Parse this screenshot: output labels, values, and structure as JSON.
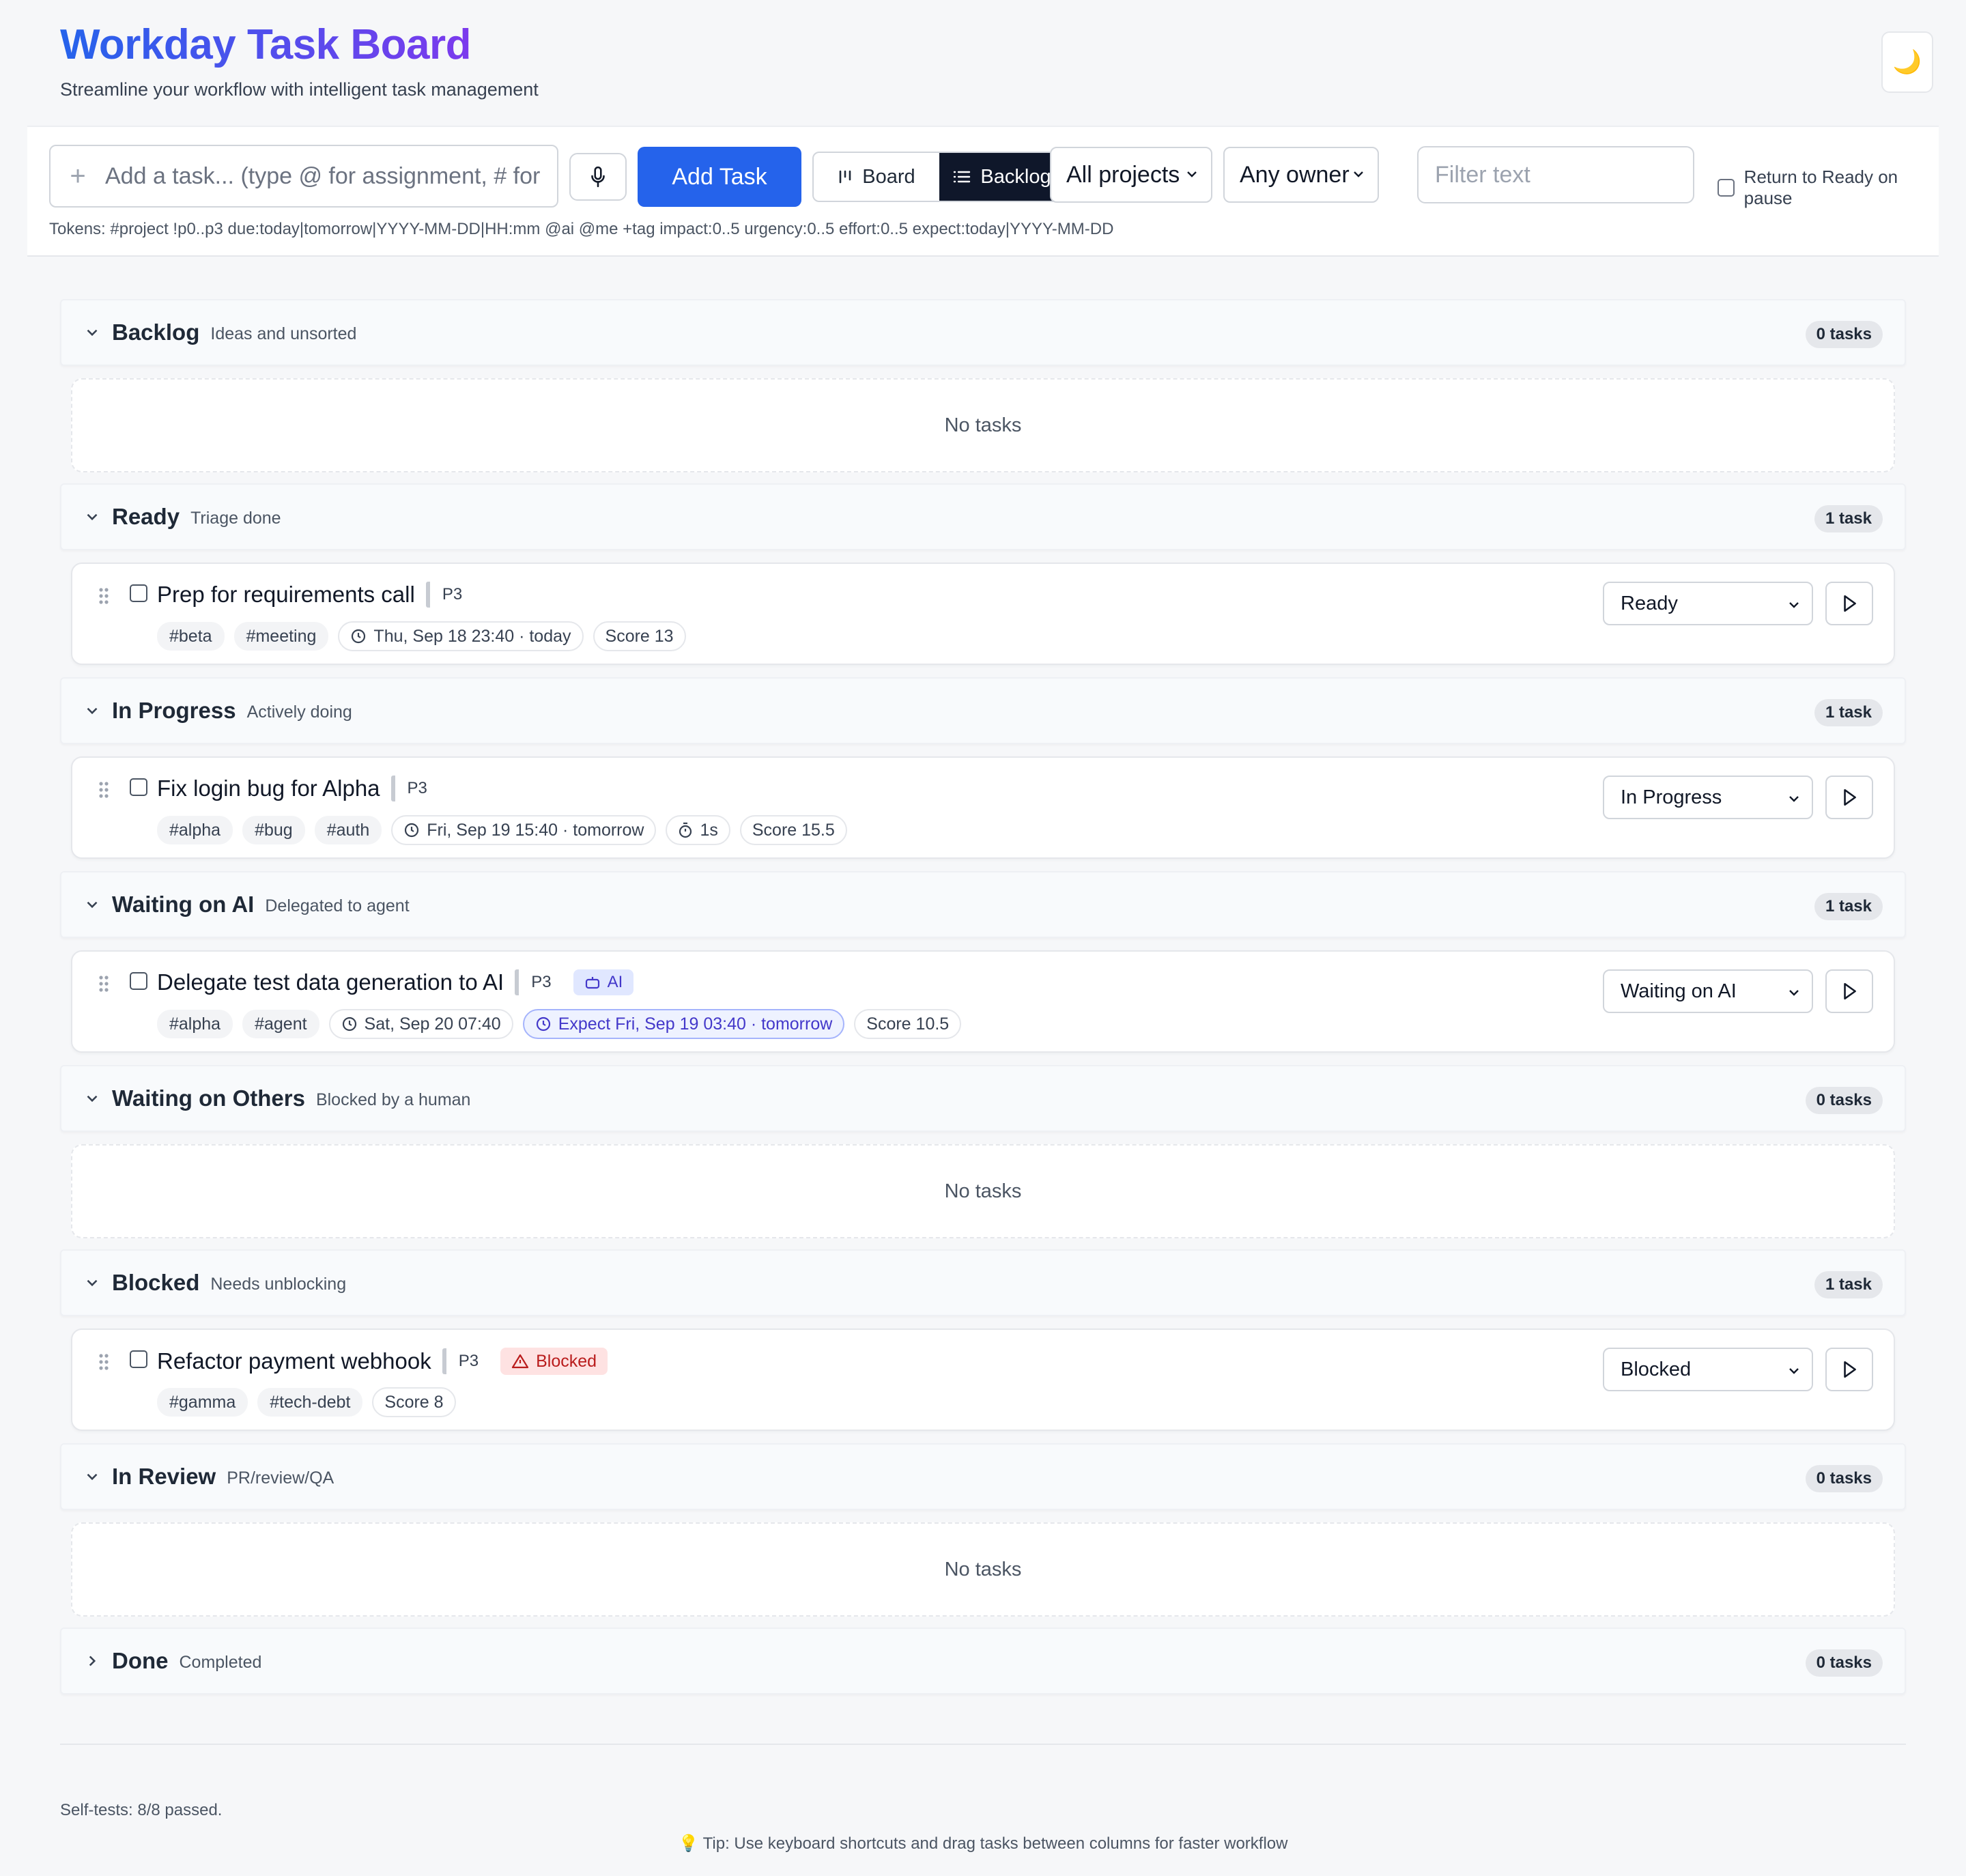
{
  "header": {
    "title": "Workday Task Board",
    "subtitle": "Streamline your workflow with intelligent task management",
    "theme_icon": "🌙"
  },
  "toolbar": {
    "task_placeholder": "Add a task... (type @ for assignment, # for project)",
    "add_label": "Add Task",
    "views": [
      {
        "label": "Board",
        "active": false
      },
      {
        "label": "Backlog",
        "active": true
      }
    ],
    "project_filter": "All projects",
    "owner_filter": "Any owner",
    "filter_placeholder": "Filter text",
    "pause_label": "Return to Ready on pause",
    "tokens_hint": "Tokens: #project !p0..p3 due:today|tomorrow|YYYY-MM-DD|HH:mm @ai @me +tag impact:0..5 urgency:0..5 effort:0..5 expect:today|YYYY-MM-DD"
  },
  "sections": [
    {
      "title": "Backlog",
      "subtitle": "Ideas and unsorted",
      "count": "0 tasks",
      "empty": "No tasks",
      "expanded": true
    },
    {
      "title": "Ready",
      "subtitle": "Triage done",
      "count": "1 task",
      "expanded": true,
      "task": {
        "title": "Prep for requirements call",
        "priority": "P3",
        "tags": [
          "#beta",
          "#meeting"
        ],
        "due": "Thu, Sep 18 23:40 · today",
        "score": "Score 13",
        "status": "Ready"
      }
    },
    {
      "title": "In Progress",
      "subtitle": "Actively doing",
      "count": "1 task",
      "expanded": true,
      "task": {
        "title": "Fix login bug for Alpha",
        "priority": "P3",
        "tags": [
          "#alpha",
          "#bug",
          "#auth"
        ],
        "due": "Fri, Sep 19 15:40 · tomorrow",
        "timer": "1s",
        "score": "Score 15.5",
        "status": "In Progress"
      }
    },
    {
      "title": "Waiting on AI",
      "subtitle": "Delegated to agent",
      "count": "1 task",
      "expanded": true,
      "task": {
        "title": "Delegate test data generation to AI",
        "priority": "P3",
        "badge": "AI",
        "tags": [
          "#alpha",
          "#agent"
        ],
        "due": "Sat, Sep 20 07:40",
        "expect": "Expect Fri, Sep 19 03:40 · tomorrow",
        "score": "Score 10.5",
        "status": "Waiting on AI"
      }
    },
    {
      "title": "Waiting on Others",
      "subtitle": "Blocked by a human",
      "count": "0 tasks",
      "empty": "No tasks",
      "expanded": true
    },
    {
      "title": "Blocked",
      "subtitle": "Needs unblocking",
      "count": "1 task",
      "expanded": true,
      "task": {
        "title": "Refactor payment webhook",
        "priority": "P3",
        "blocked_badge": "Blocked",
        "tags": [
          "#gamma",
          "#tech-debt"
        ],
        "score": "Score 8",
        "status": "Blocked"
      }
    },
    {
      "title": "In Review",
      "subtitle": "PR/review/QA",
      "count": "0 tasks",
      "empty": "No tasks",
      "expanded": true
    },
    {
      "title": "Done",
      "subtitle": "Completed",
      "count": "0 tasks",
      "expanded": false
    }
  ],
  "footer": {
    "selftest": "Self-tests: 8/8 passed.",
    "tip": "💡 Tip: Use keyboard shortcuts and drag tasks between columns for faster workflow"
  },
  "colors": {
    "accent": "#2563eb",
    "title_gradient_end": "#7c3aed",
    "active_view": "#0f172a",
    "blocked": "#b91c1c",
    "ai": "#4338ca"
  }
}
